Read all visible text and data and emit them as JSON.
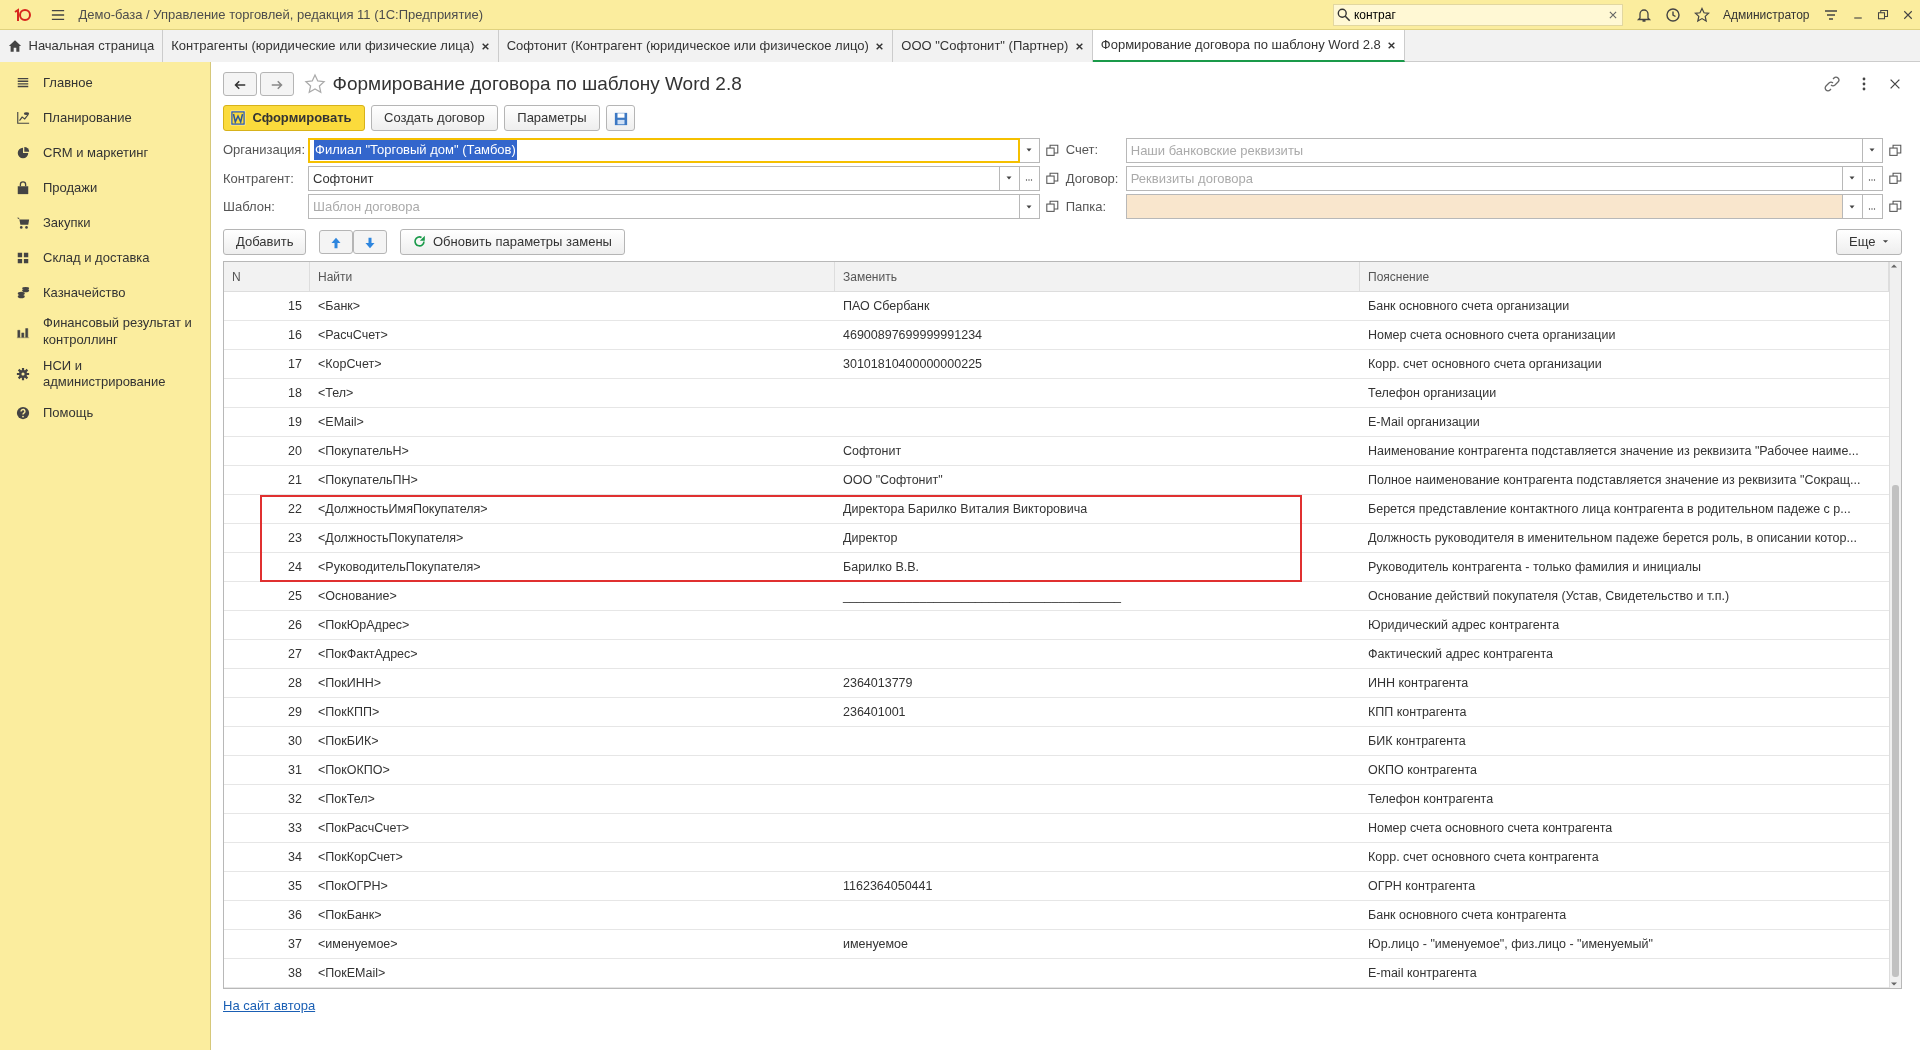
{
  "app_bar": {
    "title": "Демо-база / Управление торговлей, редакция 11  (1С:Предприятие)",
    "search": {
      "value": "контраг"
    },
    "user": "Администратор"
  },
  "tabs": [
    {
      "label": "Начальная страница",
      "selected": false,
      "home": true
    },
    {
      "label": "Контрагенты (юридические или физические лица)",
      "selected": false,
      "home": false
    },
    {
      "label": "Софтонит (Контрагент (юридическое или физическое лицо)",
      "selected": false,
      "home": false
    },
    {
      "label": "ООО \"Софтонит\" (Партнер)",
      "selected": false,
      "home": false
    },
    {
      "label": "Формирование договора по шаблону Word 2.8",
      "selected": true,
      "home": false
    }
  ],
  "sidebar": [
    {
      "label": "Главное"
    },
    {
      "label": "Планирование"
    },
    {
      "label": "CRM и маркетинг"
    },
    {
      "label": "Продажи"
    },
    {
      "label": "Закупки"
    },
    {
      "label": "Склад и доставка"
    },
    {
      "label": "Казначейство"
    },
    {
      "label": "Финансовый результат и контроллинг"
    },
    {
      "label": "НСИ и администрирование"
    },
    {
      "label": "Помощь"
    }
  ],
  "form": {
    "title": "Формирование договора по шаблону Word 2.8",
    "favorite": false,
    "buttons": [
      {
        "label": "Сформировать",
        "kind": "primary"
      },
      {
        "label": "Создать договор",
        "kind": "plain"
      },
      {
        "label": "Параметры",
        "kind": "plain"
      }
    ],
    "fields_left": [
      {
        "label": "Организация:",
        "value": "Филиал \"Торговый дом\" (Тамбов)",
        "focused": true,
        "choice": false
      },
      {
        "label": "Контрагент:",
        "value": "Софтонит",
        "focused": false,
        "choice": true
      },
      {
        "label": "Шаблон:",
        "placeholder": "Шаблон договора",
        "focused": false,
        "choice": false
      }
    ],
    "fields_right": [
      {
        "label": "Счет:",
        "placeholder": "Наши банковские реквизиты",
        "choice": false,
        "tinted": false
      },
      {
        "label": "Договор:",
        "placeholder": "Реквизиты договора",
        "choice": true,
        "tinted": false
      },
      {
        "label": "Папка:",
        "choice": true,
        "tinted": true
      }
    ],
    "add_button": "Добавить",
    "refresh_button": "Обновить параметры замены",
    "more_button": "Еще"
  },
  "table": {
    "columns": [
      "N",
      "Найти",
      "Заменить",
      "Пояснение"
    ],
    "rows": [
      {
        "n": "15",
        "find": "<Банк>",
        "replace": "ПАО Сбербанк",
        "note": "Банк основного счета организации",
        "highlighted": false
      },
      {
        "n": "16",
        "find": "<РасчСчет>",
        "replace": "46900897699999991234",
        "note": "Номер счета  основного счета организации",
        "highlighted": false
      },
      {
        "n": "17",
        "find": "<КорСчет>",
        "replace": "30101810400000000225",
        "note": "Корр. счет основного счета организации",
        "highlighted": false
      },
      {
        "n": "18",
        "find": "<Тел>",
        "replace": "",
        "note": "Телефон организации",
        "highlighted": false
      },
      {
        "n": "19",
        "find": "<EMail>",
        "replace": "",
        "note": "E-Mail организации",
        "highlighted": false
      },
      {
        "n": "20",
        "find": "<ПокупательН>",
        "replace": "Софтонит",
        "note": "Наименование контрагента подставляется значение из реквизита \"Рабочее наиме...",
        "highlighted": false
      },
      {
        "n": "21",
        "find": "<ПокупательПН>",
        "replace": "ООО \"Софтонит\"",
        "note": "Полное наименование контрагента подставляется значение из реквизита \"Сокращ...",
        "highlighted": false
      },
      {
        "n": "22",
        "find": "<ДолжностьИмяПокупателя>",
        "replace": "Директора Барилко Виталия Викторовича",
        "note": "Берется представление контактного лица контрагента в родительном падеже  с р...",
        "highlighted": true
      },
      {
        "n": "23",
        "find": "<ДолжностьПокупателя>",
        "replace": "Директор",
        "note": "Должность руководителя в именительном падеже берется роль, в описании котор...",
        "highlighted": true
      },
      {
        "n": "24",
        "find": "<РуководительПокупателя>",
        "replace": "Барилко В.В.",
        "note": "Руководитель контрагента - только фамилия и инициалы",
        "highlighted": true
      },
      {
        "n": "25",
        "find": "<Основание>",
        "replace": "________________________________________",
        "note": "Основание действий покупателя (Устав, Свидетельство и т.п.)",
        "highlighted": false
      },
      {
        "n": "26",
        "find": "<ПокЮрАдрес>",
        "replace": "",
        "note": "Юридический адрес контрагента",
        "highlighted": false
      },
      {
        "n": "27",
        "find": "<ПокФактАдрес>",
        "replace": "",
        "note": "Фактический адрес контрагента",
        "highlighted": false
      },
      {
        "n": "28",
        "find": "<ПокИНН>",
        "replace": "2364013779",
        "note": "ИНН контрагента",
        "highlighted": false
      },
      {
        "n": "29",
        "find": "<ПокКПП>",
        "replace": "236401001",
        "note": "КПП контрагента",
        "highlighted": false
      },
      {
        "n": "30",
        "find": "<ПокБИК>",
        "replace": "",
        "note": "БИК контрагента",
        "highlighted": false
      },
      {
        "n": "31",
        "find": "<ПокОКПО>",
        "replace": "",
        "note": "ОКПО контрагента",
        "highlighted": false
      },
      {
        "n": "32",
        "find": "<ПокТел>",
        "replace": "",
        "note": "Телефон контрагента",
        "highlighted": false
      },
      {
        "n": "33",
        "find": "<ПокРасчСчет>",
        "replace": "",
        "note": "Номер счета  основного счета контрагента",
        "highlighted": false
      },
      {
        "n": "34",
        "find": "<ПокКорСчет>",
        "replace": "",
        "note": "Корр. счет основного счета контрагента",
        "highlighted": false
      },
      {
        "n": "35",
        "find": "<ПокОГРН>",
        "replace": "1162364050441",
        "note": "ОГРН контрагента",
        "highlighted": false
      },
      {
        "n": "36",
        "find": "<ПокБанк>",
        "replace": "",
        "note": "Банк основного счета контрагента",
        "highlighted": false
      },
      {
        "n": "37",
        "find": "<именуемое>",
        "replace": "именуемое",
        "note": "Юр.лицо - \"именуемое\", физ.лицо - \"именуемый\"",
        "highlighted": false
      },
      {
        "n": "38",
        "find": "<ПокEMail>",
        "replace": "",
        "note": "E-mail контрагента",
        "highlighted": false
      }
    ]
  },
  "footer_link": "На сайт автора"
}
